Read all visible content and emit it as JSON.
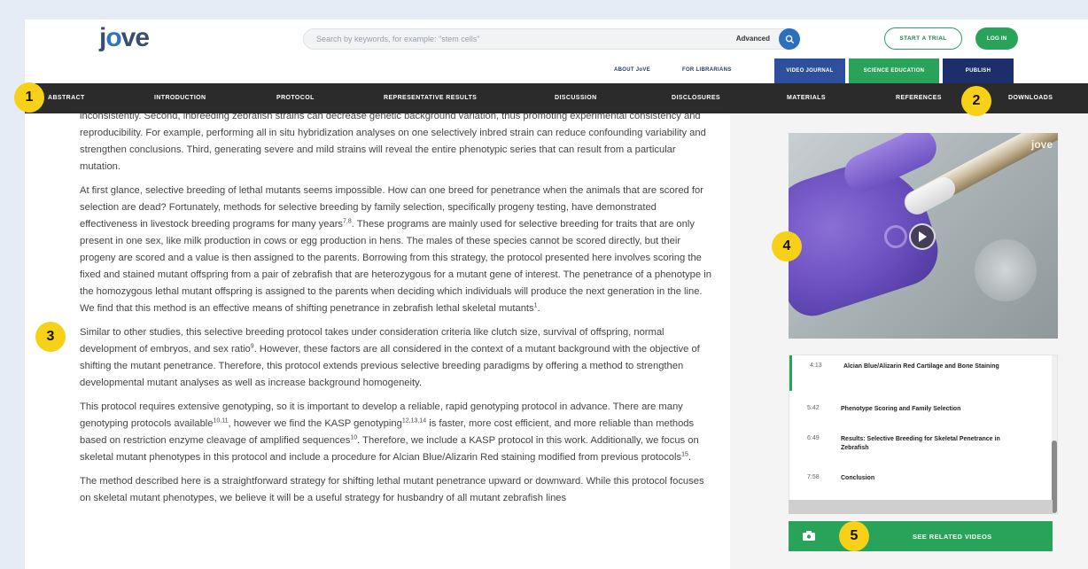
{
  "brand": {
    "logo_prefix": "j",
    "logo_o": "o",
    "logo_suffix": "ve"
  },
  "search": {
    "placeholder": "Search by keywords, for example: \"stem cells\"",
    "advanced_label": "Advanced"
  },
  "header": {
    "trial_label": "START A TRIAL",
    "login_label": "LOG IN",
    "about_label": "ABOUT JoVE",
    "librarians_label": "FOR LIBRARIANS",
    "video_journal_label": "VIDEO JOURNAL",
    "science_education_label": "SCIENCE EDUCATION",
    "publish_label": "PUBLISH"
  },
  "nav": {
    "items": [
      "ABSTRACT",
      "INTRODUCTION",
      "PROTOCOL",
      "REPRESENTATIVE RESULTS",
      "DISCUSSION",
      "DISCLOSURES",
      "MATERIALS",
      "REFERENCES",
      "DOWNLOADS"
    ]
  },
  "article": {
    "p1": "inconsistently. Second, inbreeding zebrafish strains can decrease genetic background variation, thus promoting experimental consistency and reproducibility. For example, performing all in situ hybridization analyses on one selectively inbred strain can reduce confounding variability and strengthen conclusions. Third, generating severe and mild strains will reveal the entire phenotypic series that can result from a particular mutation.",
    "p2a": "At first glance, selective breeding of lethal mutants seems impossible. How can one breed for penetrance when the animals that are scored for selection are dead? Fortunately, methods for selective breeding by family selection, specifically progeny testing, have demonstrated effectiveness in livestock breeding programs for many years",
    "p2_sup1": "7,8",
    "p2b": ". These programs are mainly used for selective breeding for traits that are only present in one sex, like milk production in cows or egg production in hens. The males of these species cannot be scored directly, but their progeny are scored and a value is then assigned to the parents. Borrowing from this strategy, the protocol presented here involves scoring the fixed and stained mutant offspring from a pair of zebrafish that are heterozygous for a mutant gene of interest. The penetrance of a phenotype in the homozygous lethal mutant offspring is assigned to the parents when deciding which individuals will produce the next generation in the line. We find that this method is an effective means of shifting penetrance in zebrafish lethal skeletal mutants",
    "p2_sup2": "1",
    "p2c": ".",
    "p3a": "Similar to other studies, this selective breeding protocol takes under consideration criteria like clutch size, survival of offspring, normal development of embryos, and sex ratio",
    "p3_sup1": "9",
    "p3b": ". However, these factors are all considered in the context of a mutant background with the objective of shifting the mutant penetrance. Therefore, this protocol extends previous selective breeding paradigms by offering a method to strengthen developmental mutant analyses as well as increase background homogeneity.",
    "p4a": "This protocol requires extensive genotyping, so it is important to develop a reliable, rapid genotyping protocol in advance. There are many genotyping protocols available",
    "p4_sup1": "10,11",
    "p4b": ", however we find the KASP genotyping",
    "p4_sup2": "12,13,14",
    "p4c": " is faster, more cost efficient, and more reliable than methods based on restriction enzyme cleavage of amplified sequences",
    "p4_sup3": "10",
    "p4d": ". Therefore, we include a KASP protocol in this work. Additionally, we focus on skeletal mutant phenotypes in this protocol and include a procedure for Alcian Blue/Alizarin Red staining modified from previous protocols",
    "p4_sup4": "15",
    "p4e": ".",
    "p5": "The method described here is a straightforward strategy for shifting lethal mutant penetrance upward or downward. While this protocol focuses on skeletal mutant phenotypes, we believe it will be a useful strategy for husbandry of all mutant zebrafish lines"
  },
  "video": {
    "watermark": "jove"
  },
  "chapters": [
    {
      "time": "4:13",
      "label": "Alcian Blue/Alizarin Red Cartilage and Bone Staining"
    },
    {
      "time": "5:42",
      "label": "Phenotype Scoring and Family Selection"
    },
    {
      "time": "6:49",
      "label": "Results: Selective Breeding for Skeletal Penetrance in Zebrafish"
    },
    {
      "time": "7:58",
      "label": "Conclusion"
    }
  ],
  "related": {
    "label": "SEE RELATED VIDEOS"
  },
  "callouts": [
    "1",
    "2",
    "3",
    "4",
    "5"
  ],
  "colors": {
    "accent_green": "#2aa35a",
    "nav_dark": "#2b2b2b",
    "journal_blue": "#2d4f9e",
    "publish_navy": "#1d2f6b",
    "callout_yellow": "#f7d117"
  }
}
